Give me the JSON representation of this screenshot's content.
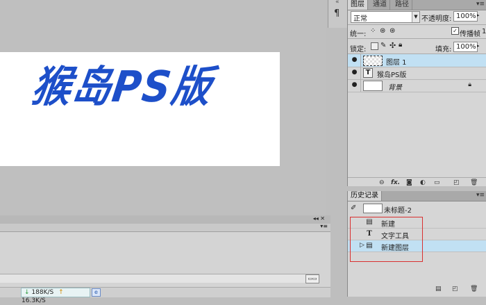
{
  "canvas": {
    "text": "猴岛PS版"
  },
  "side_strip": {
    "icon": "pilcrow-icon",
    "glyph": "¶",
    "collapse": "«"
  },
  "layers_panel": {
    "tabs": [
      "图层",
      "通道",
      "路径"
    ],
    "blend_mode": "正常",
    "opacity_label": "不透明度:",
    "opacity_value": "100%",
    "unify_label": "统一:",
    "propagate_label": "传播帧",
    "propagate_value": "1",
    "lock_label": "锁定:",
    "fill_label": "填充:",
    "fill_value": "100%",
    "layers": [
      {
        "name": "图层 1",
        "type": "raster",
        "selected": true
      },
      {
        "name": "猴岛PS版",
        "type": "text",
        "selected": false
      },
      {
        "name": "背景",
        "type": "background",
        "selected": false,
        "locked": true
      }
    ],
    "bottom_icons": [
      "link-icon",
      "fx-icon",
      "mask-icon",
      "adjustment-icon",
      "group-icon",
      "new-layer-icon",
      "trash-icon"
    ]
  },
  "history_panel": {
    "title": "历史记录",
    "snapshot": "未标题-2",
    "items": [
      {
        "label": "新建",
        "icon": "document-icon",
        "selected": false
      },
      {
        "label": "文字工具",
        "icon": "type-icon",
        "selected": false
      },
      {
        "label": "新建图层",
        "icon": "document-icon",
        "selected": true
      }
    ]
  },
  "status": {
    "download": "188K/S",
    "upload": "16.3K/S"
  },
  "colors": {
    "accent_text": "#1d4fc9",
    "selection": "#c1e0f3",
    "highlight_box": "#d93030"
  }
}
